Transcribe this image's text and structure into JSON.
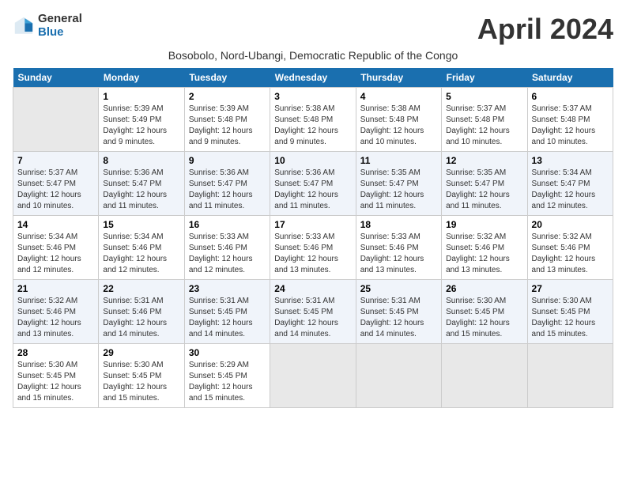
{
  "header": {
    "logo_line1": "General",
    "logo_line2": "Blue",
    "month": "April 2024",
    "subtitle": "Bosobolo, Nord-Ubangi, Democratic Republic of the Congo"
  },
  "days_of_week": [
    "Sunday",
    "Monday",
    "Tuesday",
    "Wednesday",
    "Thursday",
    "Friday",
    "Saturday"
  ],
  "weeks": [
    [
      {
        "day": "",
        "empty": true
      },
      {
        "day": "1",
        "sunrise": "5:39 AM",
        "sunset": "5:49 PM",
        "daylight": "12 hours and 9 minutes."
      },
      {
        "day": "2",
        "sunrise": "5:39 AM",
        "sunset": "5:48 PM",
        "daylight": "12 hours and 9 minutes."
      },
      {
        "day": "3",
        "sunrise": "5:38 AM",
        "sunset": "5:48 PM",
        "daylight": "12 hours and 9 minutes."
      },
      {
        "day": "4",
        "sunrise": "5:38 AM",
        "sunset": "5:48 PM",
        "daylight": "12 hours and 10 minutes."
      },
      {
        "day": "5",
        "sunrise": "5:37 AM",
        "sunset": "5:48 PM",
        "daylight": "12 hours and 10 minutes."
      },
      {
        "day": "6",
        "sunrise": "5:37 AM",
        "sunset": "5:48 PM",
        "daylight": "12 hours and 10 minutes."
      }
    ],
    [
      {
        "day": "7",
        "sunrise": "5:37 AM",
        "sunset": "5:47 PM",
        "daylight": "12 hours and 10 minutes."
      },
      {
        "day": "8",
        "sunrise": "5:36 AM",
        "sunset": "5:47 PM",
        "daylight": "12 hours and 11 minutes."
      },
      {
        "day": "9",
        "sunrise": "5:36 AM",
        "sunset": "5:47 PM",
        "daylight": "12 hours and 11 minutes."
      },
      {
        "day": "10",
        "sunrise": "5:36 AM",
        "sunset": "5:47 PM",
        "daylight": "12 hours and 11 minutes."
      },
      {
        "day": "11",
        "sunrise": "5:35 AM",
        "sunset": "5:47 PM",
        "daylight": "12 hours and 11 minutes."
      },
      {
        "day": "12",
        "sunrise": "5:35 AM",
        "sunset": "5:47 PM",
        "daylight": "12 hours and 11 minutes."
      },
      {
        "day": "13",
        "sunrise": "5:34 AM",
        "sunset": "5:47 PM",
        "daylight": "12 hours and 12 minutes."
      }
    ],
    [
      {
        "day": "14",
        "sunrise": "5:34 AM",
        "sunset": "5:46 PM",
        "daylight": "12 hours and 12 minutes."
      },
      {
        "day": "15",
        "sunrise": "5:34 AM",
        "sunset": "5:46 PM",
        "daylight": "12 hours and 12 minutes."
      },
      {
        "day": "16",
        "sunrise": "5:33 AM",
        "sunset": "5:46 PM",
        "daylight": "12 hours and 12 minutes."
      },
      {
        "day": "17",
        "sunrise": "5:33 AM",
        "sunset": "5:46 PM",
        "daylight": "12 hours and 13 minutes."
      },
      {
        "day": "18",
        "sunrise": "5:33 AM",
        "sunset": "5:46 PM",
        "daylight": "12 hours and 13 minutes."
      },
      {
        "day": "19",
        "sunrise": "5:32 AM",
        "sunset": "5:46 PM",
        "daylight": "12 hours and 13 minutes."
      },
      {
        "day": "20",
        "sunrise": "5:32 AM",
        "sunset": "5:46 PM",
        "daylight": "12 hours and 13 minutes."
      }
    ],
    [
      {
        "day": "21",
        "sunrise": "5:32 AM",
        "sunset": "5:46 PM",
        "daylight": "12 hours and 13 minutes."
      },
      {
        "day": "22",
        "sunrise": "5:31 AM",
        "sunset": "5:46 PM",
        "daylight": "12 hours and 14 minutes."
      },
      {
        "day": "23",
        "sunrise": "5:31 AM",
        "sunset": "5:45 PM",
        "daylight": "12 hours and 14 minutes."
      },
      {
        "day": "24",
        "sunrise": "5:31 AM",
        "sunset": "5:45 PM",
        "daylight": "12 hours and 14 minutes."
      },
      {
        "day": "25",
        "sunrise": "5:31 AM",
        "sunset": "5:45 PM",
        "daylight": "12 hours and 14 minutes."
      },
      {
        "day": "26",
        "sunrise": "5:30 AM",
        "sunset": "5:45 PM",
        "daylight": "12 hours and 15 minutes."
      },
      {
        "day": "27",
        "sunrise": "5:30 AM",
        "sunset": "5:45 PM",
        "daylight": "12 hours and 15 minutes."
      }
    ],
    [
      {
        "day": "28",
        "sunrise": "5:30 AM",
        "sunset": "5:45 PM",
        "daylight": "12 hours and 15 minutes."
      },
      {
        "day": "29",
        "sunrise": "5:30 AM",
        "sunset": "5:45 PM",
        "daylight": "12 hours and 15 minutes."
      },
      {
        "day": "30",
        "sunrise": "5:29 AM",
        "sunset": "5:45 PM",
        "daylight": "12 hours and 15 minutes."
      },
      {
        "day": "",
        "empty": true
      },
      {
        "day": "",
        "empty": true
      },
      {
        "day": "",
        "empty": true
      },
      {
        "day": "",
        "empty": true
      }
    ]
  ]
}
